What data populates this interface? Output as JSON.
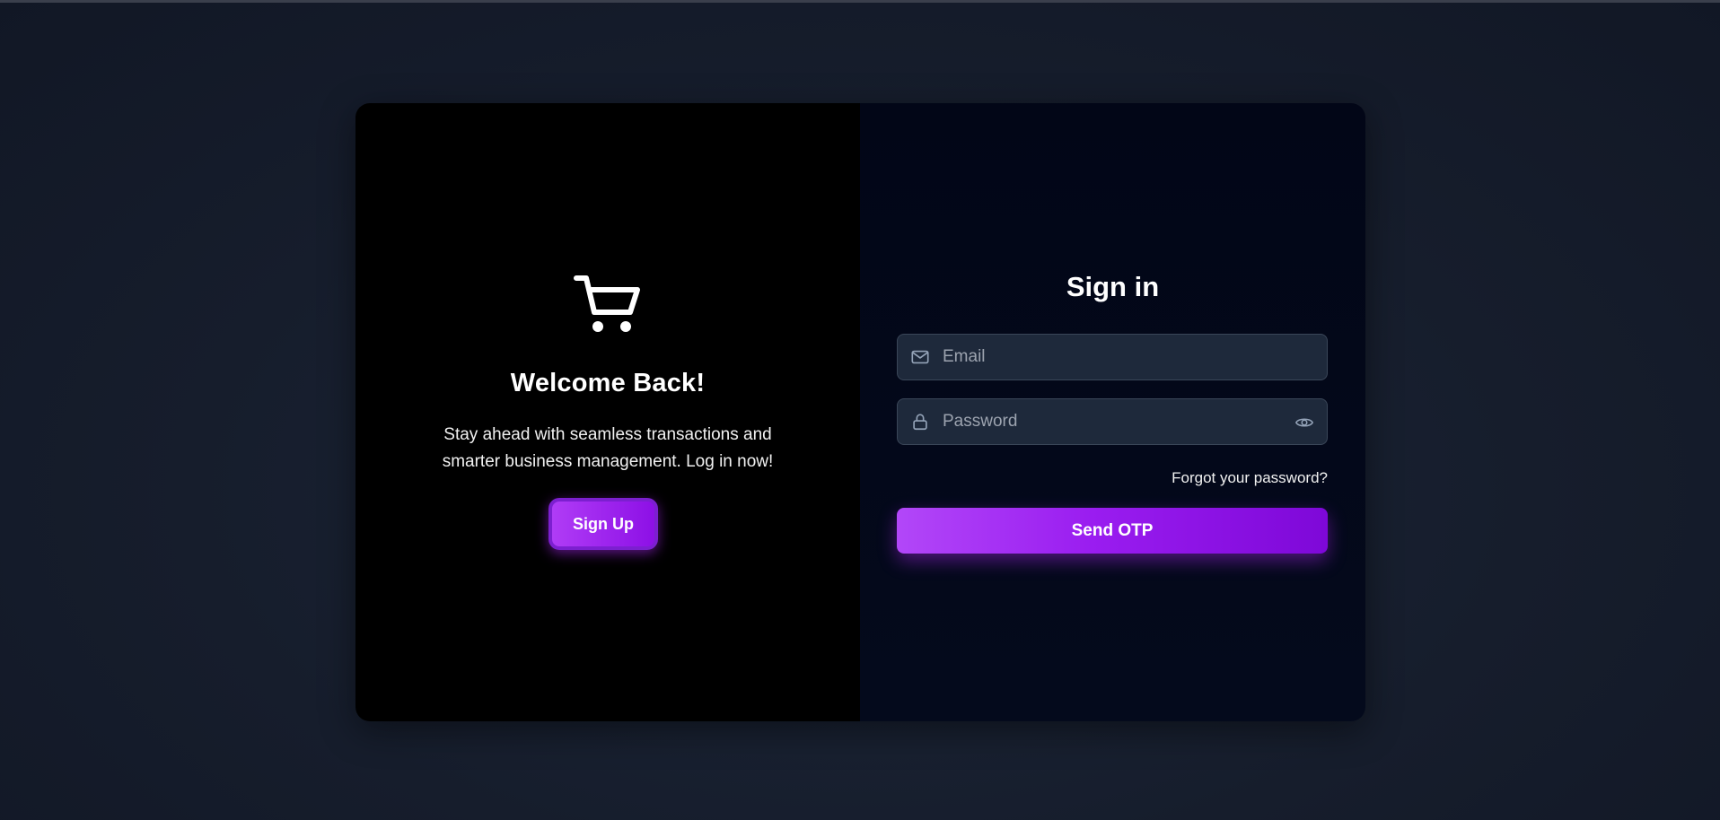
{
  "left_panel": {
    "icon": "shopping-cart-icon",
    "title": "Welcome Back!",
    "subtitle": "Stay ahead with seamless transactions and smarter business management. Log in now!",
    "signup_label": "Sign Up"
  },
  "right_panel": {
    "title": "Sign in",
    "email": {
      "icon": "mail-icon",
      "placeholder": "Email",
      "value": ""
    },
    "password": {
      "icon": "lock-icon",
      "toggle_icon": "eye-icon",
      "placeholder": "Password",
      "value": ""
    },
    "forgot_label": "Forgot your password?",
    "submit_label": "Send OTP"
  },
  "colors": {
    "accent_start": "#b247f8",
    "accent_end": "#7e08d8",
    "page_background": "#161d2c",
    "left_panel_background": "#000000",
    "right_panel_background": "#020617",
    "field_background": "#1e293b"
  }
}
